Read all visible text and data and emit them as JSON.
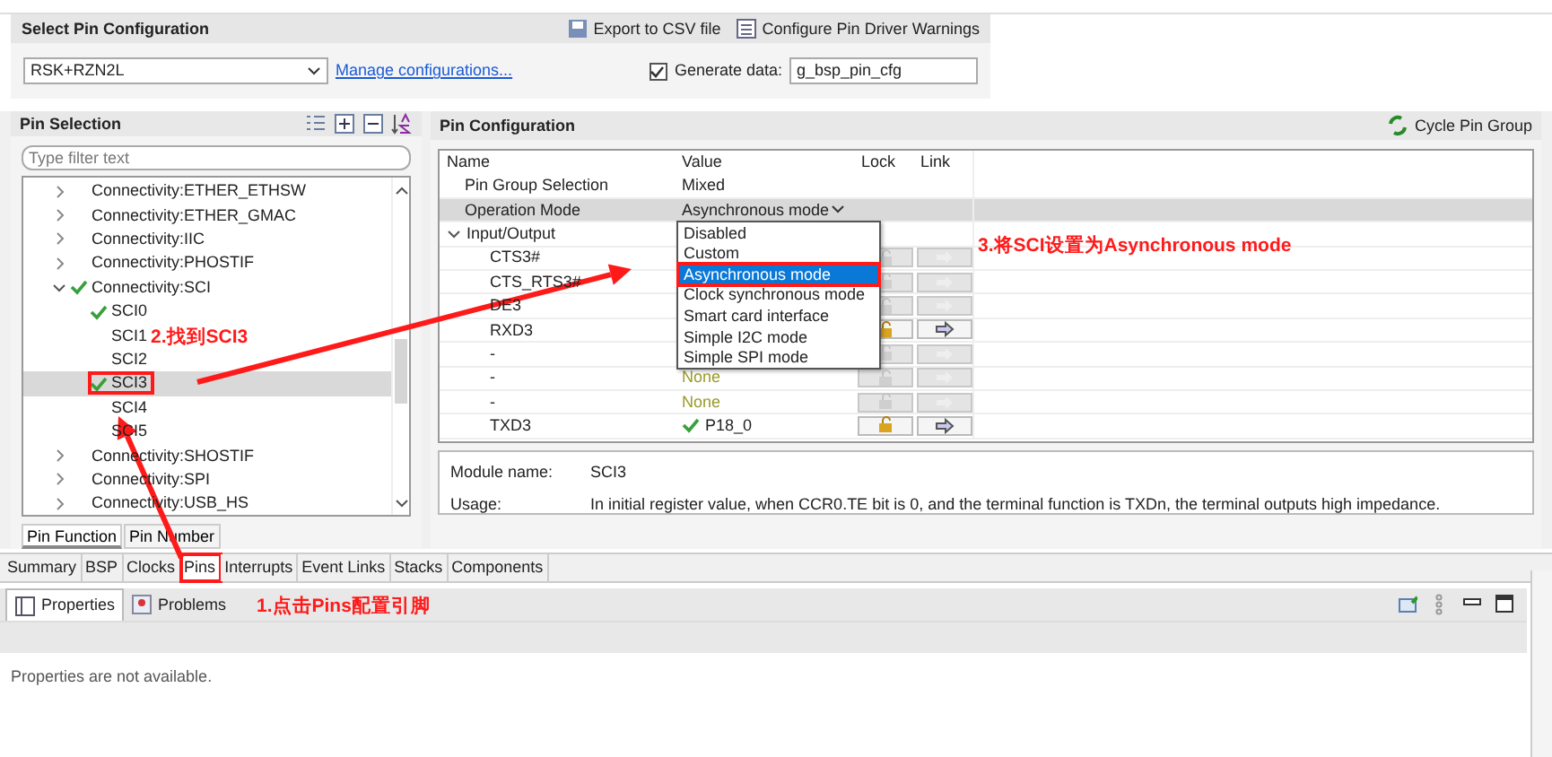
{
  "config": {
    "title": "Select Pin Configuration",
    "actions": [
      {
        "label": "Export to CSV file",
        "kind": "export"
      },
      {
        "label": "Configure Pin Driver Warnings",
        "kind": "warnings"
      }
    ],
    "board": "RSK+RZN2L",
    "manage_link": "Manage configurations...",
    "generate": {
      "label": "Generate data:",
      "checked": true,
      "value": "g_bsp_pin_cfg"
    }
  },
  "pin_selection": {
    "title": "Pin Selection",
    "filter_placeholder": "Type filter text",
    "tree": [
      {
        "label": "Connectivity:ETHER_ETHSW",
        "expanded": false,
        "checked": false
      },
      {
        "label": "Connectivity:ETHER_GMAC",
        "expanded": false,
        "checked": false
      },
      {
        "label": "Connectivity:IIC",
        "expanded": false,
        "checked": false
      },
      {
        "label": "Connectivity:PHOSTIF",
        "expanded": false,
        "checked": false
      },
      {
        "label": "Connectivity:SCI",
        "expanded": true,
        "checked": true,
        "children": [
          {
            "label": "SCI0",
            "checked": true,
            "selected": false,
            "highlighted": false
          },
          {
            "label": "SCI1",
            "checked": false,
            "selected": false,
            "highlighted": false
          },
          {
            "label": "SCI2",
            "checked": false,
            "selected": false,
            "highlighted": false
          },
          {
            "label": "SCI3",
            "checked": true,
            "selected": true,
            "highlighted": true
          },
          {
            "label": "SCI4",
            "checked": false,
            "selected": false,
            "highlighted": false
          },
          {
            "label": "SCI5",
            "checked": false,
            "selected": false,
            "highlighted": false
          }
        ]
      },
      {
        "label": "Connectivity:SHOSTIF",
        "expanded": false,
        "checked": false
      },
      {
        "label": "Connectivity:SPI",
        "expanded": false,
        "checked": false
      },
      {
        "label": "Connectivity:USB_HS",
        "expanded": false,
        "checked": false
      }
    ],
    "tabs": [
      {
        "label": "Pin Function",
        "selected": true
      },
      {
        "label": "Pin Number",
        "selected": false
      }
    ]
  },
  "pin_configuration": {
    "title": "Pin Configuration",
    "cycle_button": "Cycle Pin Group",
    "columns": [
      "Name",
      "Value",
      "Lock",
      "Link"
    ],
    "rows": [
      {
        "name": "Pin Group Selection",
        "value": "Mixed",
        "kind": "setting",
        "selected": false
      },
      {
        "name": "Operation Mode",
        "value": "Asynchronous mode",
        "kind": "dropdown",
        "selected": true
      },
      {
        "name": "Input/Output",
        "kind": "group",
        "selected": false,
        "expanded": true,
        "children": [
          {
            "name": "CTS3#",
            "kind": "pin",
            "lock_enabled": false,
            "link_enabled": false
          },
          {
            "name": "CTS_RTS3#",
            "kind": "pin",
            "lock_enabled": false,
            "link_enabled": false
          },
          {
            "name": "DE3",
            "kind": "pin",
            "lock_enabled": false,
            "link_enabled": false
          },
          {
            "name": "RXD3",
            "kind": "pin",
            "lock_enabled": true,
            "link_enabled": true
          },
          {
            "name": "-",
            "kind": "pin",
            "lock_enabled": false,
            "link_enabled": false
          },
          {
            "name": "-",
            "value": "None",
            "kind": "pin",
            "checked": false,
            "lock_enabled": false,
            "link_enabled": false
          },
          {
            "name": "-",
            "value": "None",
            "kind": "pin",
            "checked": false,
            "lock_enabled": false,
            "link_enabled": false
          },
          {
            "name": "TXD3",
            "value": "P18_0",
            "kind": "pin",
            "checked": true,
            "lock_enabled": true,
            "link_enabled": true
          }
        ]
      }
    ],
    "dropdown": [
      {
        "label": "Disabled",
        "selected": false,
        "highlighted": false
      },
      {
        "label": "Custom",
        "selected": false,
        "highlighted": false
      },
      {
        "label": "Asynchronous mode",
        "selected": true,
        "highlighted": true
      },
      {
        "label": "Clock synchronous mode",
        "selected": false,
        "highlighted": false
      },
      {
        "label": "Smart card interface",
        "selected": false,
        "highlighted": false
      },
      {
        "label": "Simple I2C mode",
        "selected": false,
        "highlighted": false
      },
      {
        "label": "Simple SPI mode",
        "selected": false,
        "highlighted": false
      }
    ],
    "module_name_label": "Module name:",
    "module_name": "SCI3",
    "usage_label": "Usage:",
    "usage": "In initial register value, when CCR0.TE bit is 0, and the terminal function is TXDn, the terminal outputs high impedance."
  },
  "editor_tabs": [
    {
      "label": "Summary",
      "selected": false,
      "highlighted": false
    },
    {
      "label": "BSP",
      "selected": false,
      "highlighted": false
    },
    {
      "label": "Clocks",
      "selected": false,
      "highlighted": false
    },
    {
      "label": "Pins",
      "selected": true,
      "highlighted": true
    },
    {
      "label": "Interrupts",
      "selected": false,
      "highlighted": false
    },
    {
      "label": "Event Links",
      "selected": false,
      "highlighted": false
    },
    {
      "label": "Stacks",
      "selected": false,
      "highlighted": false
    },
    {
      "label": "Components",
      "selected": false,
      "highlighted": false
    }
  ],
  "properties": {
    "tabs": [
      {
        "label": "Properties",
        "kind": "properties",
        "selected": true
      },
      {
        "label": "Problems",
        "kind": "problems",
        "selected": false
      }
    ],
    "message": "Properties are not available."
  },
  "annotations": [
    "1.点击Pins配置引脚",
    "2.找到SCI3",
    "3.将SCI设置为Asynchronous mode"
  ]
}
